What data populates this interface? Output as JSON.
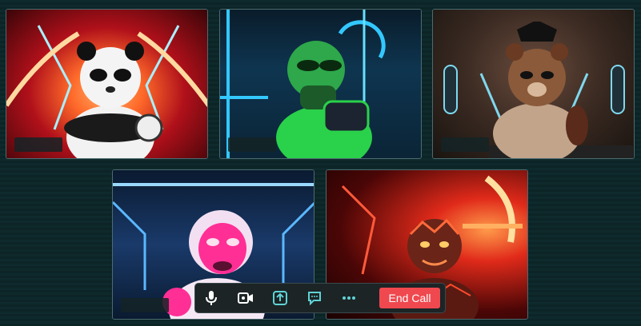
{
  "participants": [
    {
      "avatar": "panda-avatar",
      "name": ""
    },
    {
      "avatar": "green-hero-avatar",
      "name": ""
    },
    {
      "avatar": "brown-bear-avatar",
      "name": ""
    },
    {
      "avatar": "pink-cat-avatar",
      "name": ""
    },
    {
      "avatar": "lava-creature-avatar",
      "name": ""
    }
  ],
  "controls": {
    "icons": [
      "microphone-icon",
      "camera-icon",
      "share-screen-icon",
      "chat-icon",
      "more-icon"
    ],
    "end_call_label": "End Call",
    "end_call_color": "#f0484f",
    "accent_color": "#5fd3d6"
  }
}
